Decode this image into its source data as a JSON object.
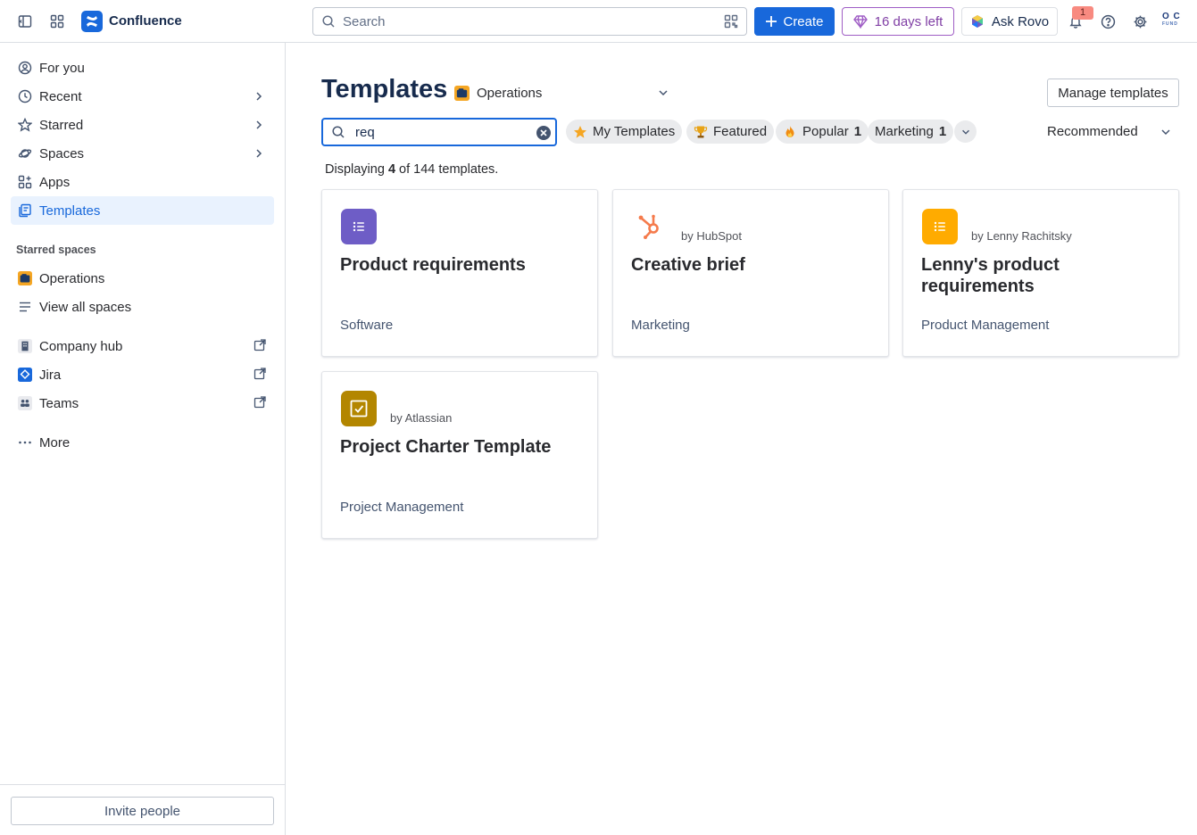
{
  "colors": {
    "primary": "#1868db",
    "trial_purple": "#803fa5",
    "badge_red": "#f88a80",
    "card_purple": "#6e5dc6",
    "card_orange": "#ffab00",
    "card_gold": "#b38600",
    "hubspot_orange": "#f57b4c"
  },
  "topbar": {
    "brand": "Confluence",
    "search_placeholder": "Search",
    "create_label": "Create",
    "trial_label": "16 days left",
    "rovo_label": "Ask Rovo",
    "notification_count": "1",
    "avatar_initials": "O C",
    "avatar_sub": "FUND"
  },
  "sidebar": {
    "items": [
      {
        "label": "For you",
        "icon": "user-circle-icon"
      },
      {
        "label": "Recent",
        "icon": "clock-icon"
      },
      {
        "label": "Starred",
        "icon": "star-icon"
      },
      {
        "label": "Spaces",
        "icon": "spaces-icon"
      },
      {
        "label": "Apps",
        "icon": "apps-icon"
      },
      {
        "label": "Templates",
        "icon": "template-icon"
      }
    ],
    "starred_heading": "Starred spaces",
    "starred_spaces": [
      {
        "label": "Operations",
        "icon": "space-avatar-icon"
      },
      {
        "label": "View all spaces",
        "icon": "list-icon"
      }
    ],
    "external": [
      {
        "label": "Company hub",
        "icon": "building-icon"
      },
      {
        "label": "Jira",
        "icon": "jira-icon"
      },
      {
        "label": "Teams",
        "icon": "teams-icon"
      }
    ],
    "more_label": "More",
    "invite_label": "Invite people"
  },
  "main": {
    "title": "Templates",
    "space_name": "Operations",
    "manage_label": "Manage templates",
    "search_value": "req",
    "filters": [
      {
        "label": "My Templates",
        "count": "",
        "icon": "star-icon"
      },
      {
        "label": "Featured",
        "count": "",
        "icon": "trophy-icon"
      },
      {
        "label": "Popular",
        "count": "1",
        "icon": "fire-icon"
      },
      {
        "label": "Marketing",
        "count": "1",
        "icon": ""
      }
    ],
    "sort_label": "Recommended",
    "count_prefix": "Displaying",
    "count_shown": "4",
    "count_middle": "of 144 templates.",
    "cards": [
      {
        "title": "Product requirements",
        "by": "",
        "category": "Software"
      },
      {
        "title": "Creative brief",
        "by": "by HubSpot",
        "category": "Marketing"
      },
      {
        "title": "Lenny's product requirements",
        "by": "by Lenny Rachitsky",
        "category": "Product Management"
      },
      {
        "title": "Project Charter Template",
        "by": "by Atlassian",
        "category": "Project Management"
      }
    ]
  }
}
